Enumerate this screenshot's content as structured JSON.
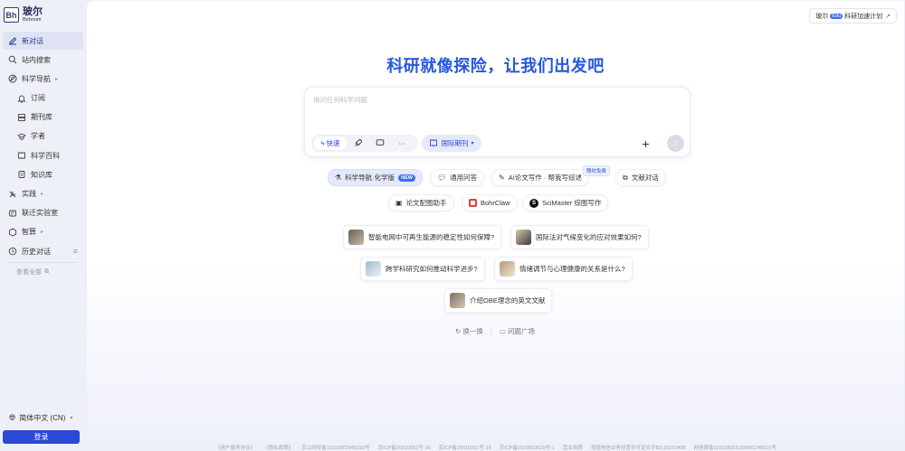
{
  "brand": {
    "logo_mark": "Bh",
    "name_cn": "玻尔",
    "name_en": "Bohrium"
  },
  "sidebar": {
    "items": [
      {
        "label": "新对话",
        "icon": "edit-icon",
        "active": true
      },
      {
        "label": "站内搜索",
        "icon": "search-icon"
      },
      {
        "label": "科学导航",
        "icon": "compass-icon",
        "caret": "▸"
      },
      {
        "label": "订阅",
        "icon": "bell-icon",
        "sub": true
      },
      {
        "label": "期刊库",
        "icon": "layers-icon",
        "sub": true
      },
      {
        "label": "学者",
        "icon": "scholar-icon",
        "sub": true
      },
      {
        "label": "科学百科",
        "icon": "book-icon",
        "sub": true
      },
      {
        "label": "知识库",
        "icon": "database-icon",
        "sub": true
      },
      {
        "label": "实践",
        "icon": "tools-icon",
        "caret": "▸"
      },
      {
        "label": "联迁实验室",
        "icon": "lab-icon"
      },
      {
        "label": "智算",
        "icon": "compute-icon",
        "caret": "▸"
      },
      {
        "label": "历史对话",
        "icon": "clock-icon"
      }
    ],
    "view_all": "查看全部",
    "language": "简体中文 (CN)",
    "login": "登录"
  },
  "promo": {
    "brand": "玻尔",
    "tag": "Edu",
    "label": "科研加速计划",
    "arrow": "↗"
  },
  "hero_title": "科研就像探险，让我们出发吧",
  "composer": {
    "placeholder": "询问任何科学问题",
    "mode_fast": "快速",
    "journal": "国际期刊",
    "plus": "+",
    "send": "↑"
  },
  "chips": {
    "sci_nav": "科学导航·化学版",
    "new_badge": "NEW",
    "general_qa": "通用问答",
    "ai_paper": "AI论文写作 · 帮我写综述",
    "free_tag": "限时免费",
    "lit_chat": "文献对话",
    "figure_helper": "论文配图助手",
    "bohrclaw": "BohrClaw",
    "scimaster": "SciMaster 综图写作"
  },
  "questions": [
    "智能电网中可再生能源的稳定性如何保障?",
    "国际法对气候变化的应对效果如何?",
    "跨学科研究如何推动科学进步?",
    "情绪调节与心理健康的关系是什么?",
    "介绍OBE理念的英文文献"
  ],
  "footer_actions": {
    "refresh": "换一换",
    "plaza": "问题广场"
  },
  "legal": [
    "《用户服务协议》",
    "《隐私政策》",
    "京公网安备11010802045318号",
    "京ICP备20010051号-16",
    "京ICP备20010051号-15",
    "京ICP备2023003620号-1",
    "营业执照",
    "增值电信业务经营许可证合字B2-20210408",
    "网信算备110108025106801240015号"
  ]
}
